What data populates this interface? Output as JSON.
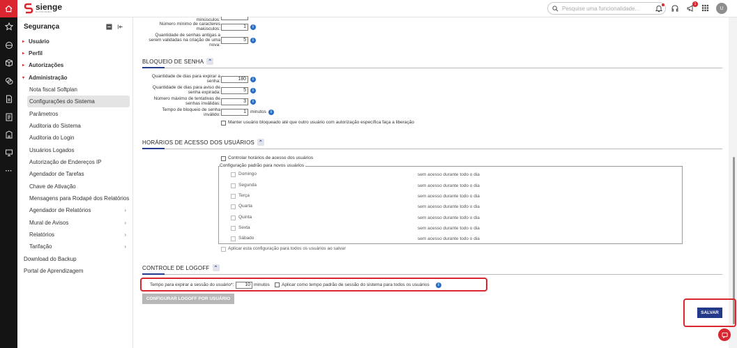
{
  "app": {
    "logo_text": "sienge",
    "logo_sub": "PLATAFORMA"
  },
  "topbar": {
    "search_placeholder": "Pesquise uma funcionalidade...",
    "notifications_badge": "1",
    "avatar_initial": "U"
  },
  "sidebar": {
    "title": "Segurança",
    "items": [
      {
        "label": "Usuário"
      },
      {
        "label": "Perfil"
      },
      {
        "label": "Autorizações"
      },
      {
        "label": "Administração"
      },
      {
        "label": "Nota fiscal Softplan"
      },
      {
        "label": "Configurações do Sistema"
      },
      {
        "label": "Parâmetros"
      },
      {
        "label": "Auditoria do Sistema"
      },
      {
        "label": "Auditoria do Login"
      },
      {
        "label": "Usuários Logados"
      },
      {
        "label": "Autorização de Endereços IP"
      },
      {
        "label": "Agendador de Tarefas"
      },
      {
        "label": "Chave de Ativação"
      },
      {
        "label": "Mensagens para Rodapé dos Relatórios"
      },
      {
        "label": "Agendador de Relatórios"
      },
      {
        "label": "Mural de Avisos"
      },
      {
        "label": "Relatórios"
      },
      {
        "label": "Tarifação"
      },
      {
        "label": "Download do Backup"
      },
      {
        "label": "Portal de Aprendizagem"
      }
    ]
  },
  "password_top": {
    "minusculos_label": "minúsculos:",
    "min_upper_label": "Número mínimo de caracteres maiúsculos:",
    "min_upper_value": "1",
    "old_pw_label": "Quantidade de senhas antigas a serem validadas na criação de uma nova:",
    "old_pw_value": "5"
  },
  "bloqueio": {
    "title": "BLOQUEIO DE SENHA",
    "expire_label": "Quantidade de dias para expirar a senha:",
    "expire_value": "180",
    "warn_label": "Quantidade de dias para aviso de senha expirada:",
    "warn_value": "5",
    "attempts_label": "Número máximo de tentativas de senhas inválidas:",
    "attempts_value": "3",
    "lock_label": "Tempo de bloqueio de senha inválido:",
    "lock_value": "1",
    "lock_unit": "minutos",
    "keep_locked_label": "Manter usuário bloqueado até que outro usuário com autorização específica faça a liberação"
  },
  "horarios": {
    "title": "HORÁRIOS DE ACESSO DOS USUÁRIOS",
    "control_label": "Controlar horários de acesso dos usuários",
    "legend": "Configuração padrão para novos usuários",
    "days": [
      {
        "day": "Domingo",
        "status": "sem acesso durante todo o dia"
      },
      {
        "day": "Segunda",
        "status": "sem acesso durante todo o dia"
      },
      {
        "day": "Terça",
        "status": "sem acesso durante todo o dia"
      },
      {
        "day": "Quarta",
        "status": "sem acesso durante todo o dia"
      },
      {
        "day": "Quinta",
        "status": "sem acesso durante todo o dia"
      },
      {
        "day": "Sexta",
        "status": "sem acesso durante todo o dia"
      },
      {
        "day": "Sábado",
        "status": "sem acesso durante todo o dia"
      }
    ],
    "apply_all_label": "Aplicar esta configuração para todos os usuários ao salvar"
  },
  "logoff": {
    "title": "CONTROLE DE LOGOFF",
    "session_label": "Tempo para expirar a sessão do usuário*:",
    "session_value": "10",
    "session_unit": "minutos",
    "default_label": "Aplicar como tempo padrão de sessão do sistema para todos os usuários",
    "config_button": "CONFIGURAR LOGOFF POR USUÁRIO"
  },
  "actions": {
    "save": "SALVAR"
  },
  "colors": {
    "brand": "#d9262f",
    "primary": "#233a8a",
    "rail": "#141414"
  }
}
